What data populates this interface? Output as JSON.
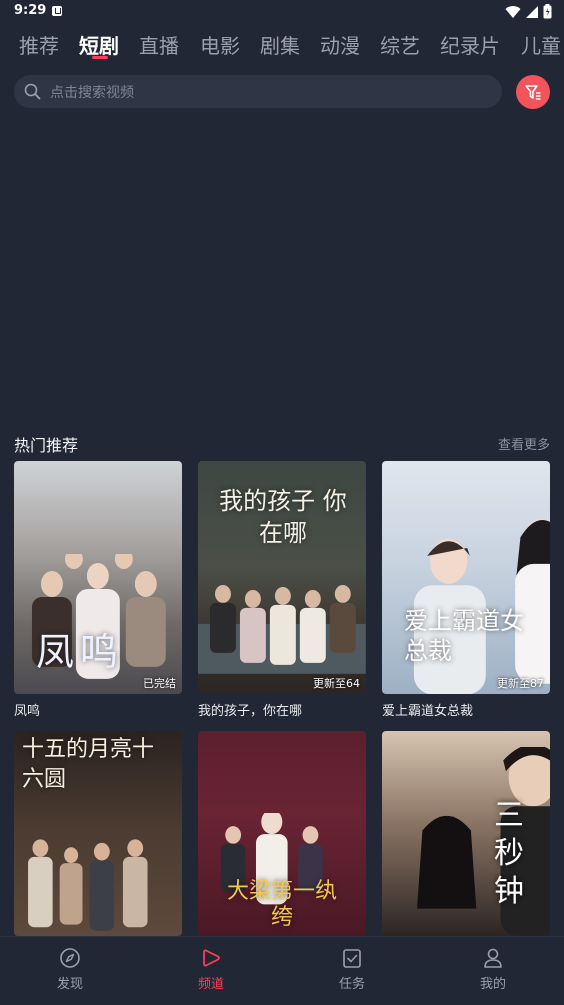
{
  "status": {
    "time": "9:29"
  },
  "tabs": [
    "推荐",
    "短剧",
    "直播",
    "电影",
    "剧集",
    "动漫",
    "综艺",
    "纪录片",
    "儿童"
  ],
  "active_tab_index": 1,
  "search": {
    "placeholder": "点击搜索视频"
  },
  "section": {
    "title": "热门推荐",
    "more_label": "查看更多"
  },
  "cards": [
    {
      "title": "凤鸣",
      "poster_title": "凤鸣",
      "badge": "已完结"
    },
    {
      "title": "我的孩子，你在哪",
      "poster_title": "我的孩子 你在哪",
      "badge": "更新至64"
    },
    {
      "title": "爱上霸道女总裁",
      "poster_title": "爱上霸道女总裁",
      "badge": "更新至87"
    },
    {
      "title": "",
      "poster_title": "十五的月亮十六圆",
      "badge": ""
    },
    {
      "title": "",
      "poster_title": "大梁第一纨绔",
      "badge": ""
    },
    {
      "title": "",
      "poster_title": "三秒钟",
      "badge": ""
    }
  ],
  "nav": [
    {
      "label": "发现",
      "icon": "compass-icon"
    },
    {
      "label": "频道",
      "icon": "play-icon"
    },
    {
      "label": "任务",
      "icon": "task-icon"
    },
    {
      "label": "我的",
      "icon": "user-icon"
    }
  ],
  "colors": {
    "accent": "#ff3d5a",
    "background": "#222735",
    "search_bg": "#2f3545",
    "filter_button": "#f2545b"
  }
}
